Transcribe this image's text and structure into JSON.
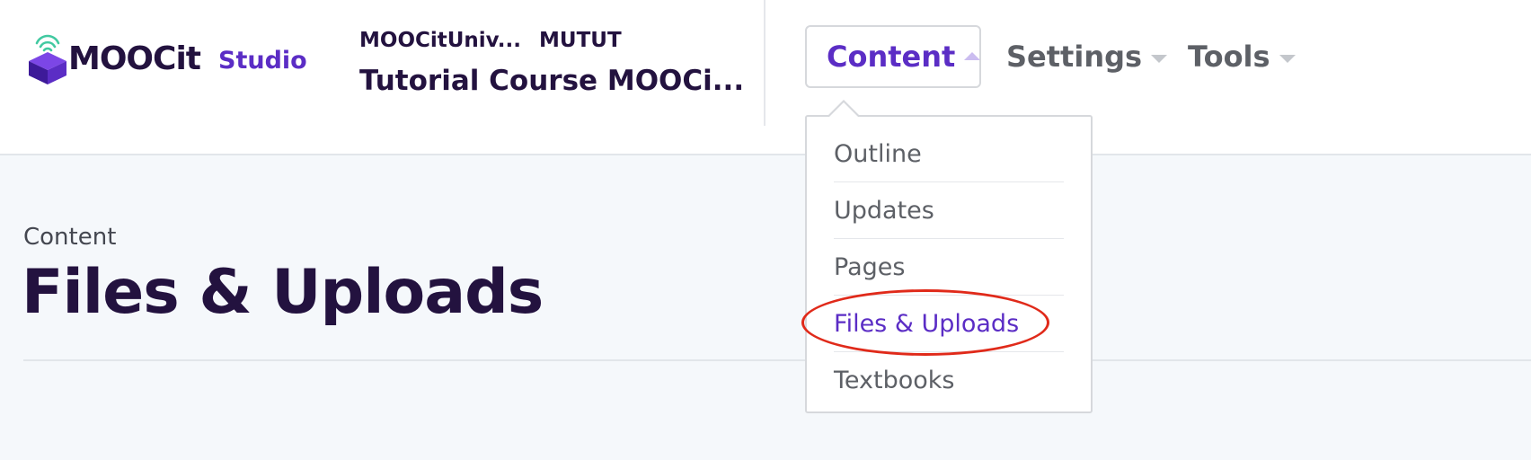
{
  "brand": {
    "logo_text": "MOOCit",
    "product": "Studio",
    "colors": {
      "primary_purple": "#5b2dc5",
      "dark_navy": "#23123f",
      "highlight_red": "#e02a1a",
      "logo_green": "#41c9a1"
    },
    "icon": "cube-wifi-logo-icon"
  },
  "course": {
    "org": "MOOCitUniv...",
    "number": "MUTUT",
    "title": "Tutorial Course MOOCi..."
  },
  "nav": {
    "items": [
      {
        "label": "Content",
        "icon": "caret-up-icon",
        "expanded": true
      },
      {
        "label": "Settings",
        "icon": "caret-down-icon",
        "expanded": false
      },
      {
        "label": "Tools",
        "icon": "caret-down-icon",
        "expanded": false
      }
    ]
  },
  "dropdown": {
    "items": [
      {
        "label": "Outline"
      },
      {
        "label": "Updates"
      },
      {
        "label": "Pages"
      },
      {
        "label": "Files & Uploads",
        "highlighted": true
      },
      {
        "label": "Textbooks"
      }
    ]
  },
  "page": {
    "breadcrumb": "Content",
    "title": "Files & Uploads"
  }
}
